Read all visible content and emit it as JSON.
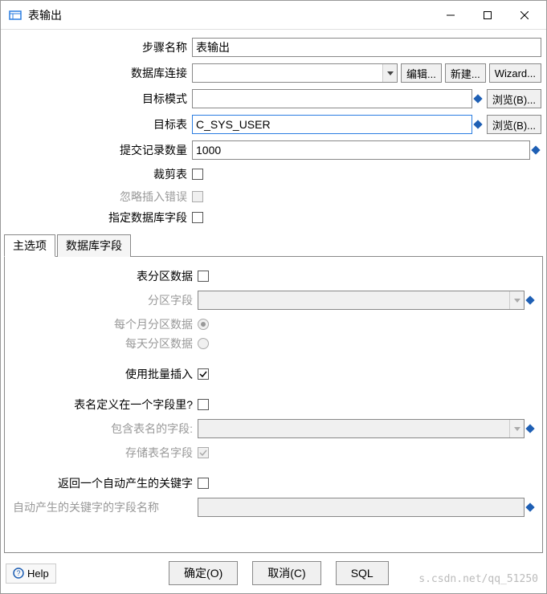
{
  "window": {
    "title": "表输出",
    "min": "minimize",
    "max": "maximize",
    "close": "close"
  },
  "form": {
    "step_name_label": "步骤名称",
    "step_name_value": "表输出",
    "db_conn_label": "数据库连接",
    "db_conn_value": "",
    "edit_btn": "编辑...",
    "new_btn": "新建...",
    "wizard_btn": "Wizard...",
    "target_schema_label": "目标模式",
    "target_schema_value": "",
    "browse_b_btn": "浏览(B)...",
    "target_table_label": "目标表",
    "target_table_value": "C_SYS_USER",
    "commit_size_label": "提交记录数量",
    "commit_size_value": "1000",
    "truncate_label": "裁剪表",
    "ignore_insert_err_label": "忽略插入错误",
    "specify_db_fields_label": "指定数据库字段"
  },
  "tabs": {
    "main": "主选项",
    "dbfields": "数据库字段"
  },
  "main_tab": {
    "partition_data_label": "表分区数据",
    "partition_field_label": "分区字段",
    "partition_field_value": "",
    "partition_monthly_label": "每个月分区数据",
    "partition_daily_label": "每天分区数据",
    "batch_insert_label": "使用批量插入",
    "tablename_in_field_label": "表名定义在一个字段里?",
    "field_contain_tablename_label": "包含表名的字段:",
    "field_contain_tablename_value": "",
    "store_tablename_field_label": "存储表名字段",
    "return_autokey_label": "返回一个自动产生的关键字",
    "autokey_fieldname_label": "自动产生的关键字的字段名称",
    "autokey_fieldname_value": ""
  },
  "buttons": {
    "help": "Help",
    "ok": "确定(O)",
    "cancel": "取消(C)",
    "sql": "SQL"
  },
  "watermark": "s.csdn.net/qq_51250"
}
